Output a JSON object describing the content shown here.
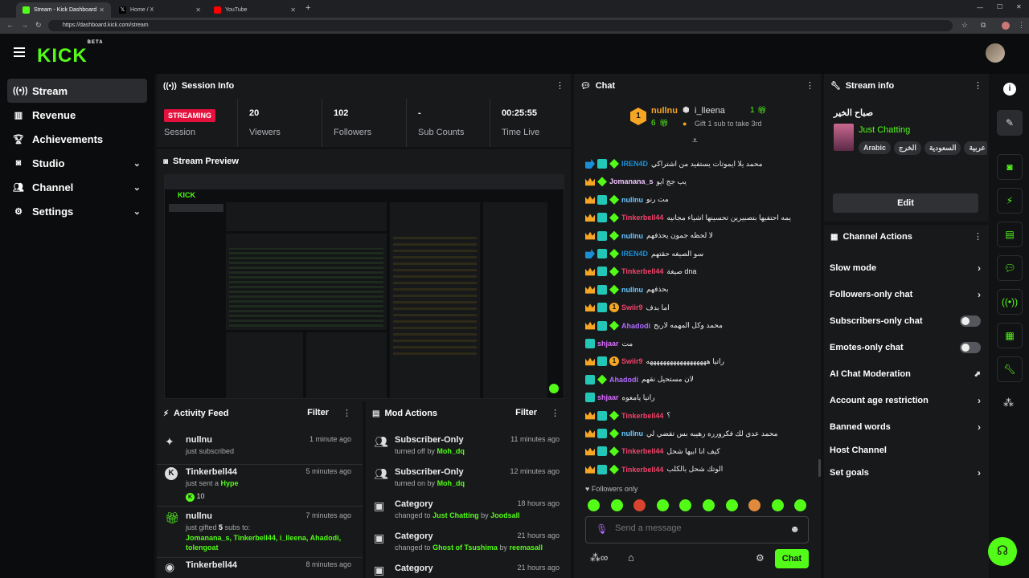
{
  "browser": {
    "tabs": [
      {
        "title": "Stream - Kick Dashboard"
      },
      {
        "title": "Home / X"
      },
      {
        "title": "YouTube"
      }
    ],
    "url": "https://dashboard.kick.com/stream"
  },
  "app": {
    "logo": "KICK",
    "logo_badge": "BETA"
  },
  "sidebar": {
    "items": [
      {
        "label": "Stream",
        "icon": "broadcast-icon"
      },
      {
        "label": "Revenue",
        "icon": "chart-icon"
      },
      {
        "label": "Achievements",
        "icon": "trophy-icon"
      },
      {
        "label": "Studio",
        "icon": "camera-icon"
      },
      {
        "label": "Channel",
        "icon": "users-icon"
      },
      {
        "label": "Settings",
        "icon": "gear-icon"
      }
    ]
  },
  "session": {
    "title": "Session Info",
    "badge": "STREAMING",
    "session_label": "Session",
    "stats": [
      {
        "value": "20",
        "label": "Viewers"
      },
      {
        "value": "102",
        "label": "Followers"
      },
      {
        "value": "-",
        "label": "Sub Counts"
      },
      {
        "value": "00:25:55",
        "label": "Time Live"
      }
    ]
  },
  "preview": {
    "title": "Stream Preview"
  },
  "activity": {
    "title": "Activity Feed",
    "filter": "Filter",
    "items": [
      {
        "name": "nullnu",
        "time": "1 minute ago",
        "text": "just subscribed"
      },
      {
        "name": "Tinkerbell44",
        "time": "5 minutes ago",
        "text": "just sent a",
        "highlight": "Hype",
        "amount": "10"
      },
      {
        "name": "nullnu",
        "time": "7 minutes ago",
        "text": "just gifted",
        "count": "5",
        "text2": "subs to:",
        "recipients": "Jomanana_s, Tinkerbell44, i_lleena, Ahadodi, tolengoat"
      },
      {
        "name": "Tinkerbell44",
        "time": "8 minutes ago"
      }
    ]
  },
  "modactions": {
    "title": "Mod Actions",
    "filter": "Filter",
    "items": [
      {
        "title": "Subscriber-Only",
        "time": "11 minutes ago",
        "text": "turned off by",
        "by": "Moh_dq"
      },
      {
        "title": "Subscriber-Only",
        "time": "12 minutes ago",
        "text": "turned on by",
        "by": "Moh_dq"
      },
      {
        "title": "Category",
        "time": "18 hours ago",
        "text": "changed to",
        "target": "Just Chatting",
        "by_text": "by",
        "by": "Joodsall"
      },
      {
        "title": "Category",
        "time": "21 hours ago",
        "text": "changed to",
        "target": "Ghost of Tsushima",
        "by_text": "by",
        "by": "reemasall"
      },
      {
        "title": "Category",
        "time": "21 hours ago"
      }
    ]
  },
  "chat": {
    "title": "Chat",
    "top_gifter": {
      "name": "nullnu",
      "count": "6",
      "rank": "1"
    },
    "second": {
      "name": "i_lleena",
      "count": "1"
    },
    "gift_prompt": "Gift 1 sub to take 3rd",
    "messages": [
      {
        "user": "IREN4D",
        "color": "#1b8fd6",
        "badges": [
          "sub",
          "teal",
          "diamond"
        ],
        "text": "محمد يلا ايموتات يستفيد من اشتراكي"
      },
      {
        "user": "Jomanana_s",
        "color": "#f2c4ff",
        "badges": [
          "crown",
          "diamond"
        ],
        "text": "يب جج ايو"
      },
      {
        "user": "nullnu",
        "color": "#67c6ff",
        "badges": [
          "crown",
          "teal",
          "diamond"
        ],
        "text": "مت رنو"
      },
      {
        "user": "Tinkerbell44",
        "color": "#f0436a",
        "badges": [
          "crown",
          "teal",
          "diamond"
        ],
        "text": "يمه احتفيها بتصبيرين تحسينها اشياء مجانيه"
      },
      {
        "user": "nullnu",
        "color": "#67c6ff",
        "badges": [
          "crown",
          "teal",
          "diamond"
        ],
        "text": "لا لحظه جمون يحذفهم"
      },
      {
        "user": "IREN4D",
        "color": "#1b8fd6",
        "badges": [
          "sub",
          "teal",
          "diamond"
        ],
        "text": "سو الصيغه حقتهم"
      },
      {
        "user": "Tinkerbell44",
        "color": "#f0436a",
        "badges": [
          "crown",
          "teal",
          "diamond"
        ],
        "text": "صيغة dna"
      },
      {
        "user": "nullnu",
        "color": "#67c6ff",
        "badges": [
          "crown",
          "teal",
          "diamond"
        ],
        "text": "بحذفهم"
      },
      {
        "user": "Swiir9",
        "color": "#f0436a",
        "badges": [
          "crown",
          "teal",
          "one"
        ],
        "text": "اما بدف"
      },
      {
        "user": "Ahadodi",
        "color": "#b06cff",
        "badges": [
          "crown",
          "teal",
          "diamond"
        ],
        "text": "محمد وكل المهمه لاربح"
      },
      {
        "user": "shjaar",
        "color": "#d96cff",
        "badges": [
          "teal"
        ],
        "text": "مت"
      },
      {
        "user": "Swiir9",
        "color": "#f0436a",
        "badges": [
          "crown",
          "teal",
          "one"
        ],
        "text": "راتيا ههههههههههههههههههه"
      },
      {
        "user": "Ahadodi",
        "color": "#b06cff",
        "badges": [
          "teal",
          "diamond"
        ],
        "text": "لان مستحيل نقهم"
      },
      {
        "user": "shjaar",
        "color": "#d96cff",
        "badges": [
          "teal"
        ],
        "text": "راتيا يامعوه"
      },
      {
        "user": "Tinkerbell44",
        "color": "#f0436a",
        "badges": [
          "crown",
          "teal",
          "diamond"
        ],
        "text": "؟"
      },
      {
        "user": "nullnu",
        "color": "#67c6ff",
        "badges": [
          "crown",
          "teal",
          "diamond"
        ],
        "text": "محمد عدي لك فكرورره رهيبه بس تقضي لي"
      },
      {
        "user": "Tinkerbell44",
        "color": "#f0436a",
        "badges": [
          "crown",
          "teal",
          "diamond"
        ],
        "text": "كيف انا ابيها شحل"
      },
      {
        "user": "Tinkerbell44",
        "color": "#f0436a",
        "badges": [
          "crown",
          "teal",
          "diamond"
        ],
        "text": "الوتك شحل بالكلب"
      }
    ],
    "followers_only": "Followers only",
    "input_placeholder": "Send a message",
    "send_label": "Chat"
  },
  "streaminfo": {
    "title": "Stream info",
    "stream_title": "صباح الخير",
    "category": "Just Chatting",
    "tags": [
      "Arabic",
      "الخرج",
      "السعودية",
      "عربية"
    ],
    "edit_label": "Edit"
  },
  "channelactions": {
    "title": "Channel Actions",
    "items": [
      {
        "label": "Slow mode",
        "control": "chevron"
      },
      {
        "label": "Followers-only chat",
        "control": "chevron"
      },
      {
        "label": "Subscribers-only chat",
        "control": "toggle"
      },
      {
        "label": "Emotes-only chat",
        "control": "toggle"
      },
      {
        "label": "AI Chat Moderation",
        "control": "external"
      },
      {
        "label": "Account age restriction",
        "control": "chevron"
      },
      {
        "label": "Banned words",
        "control": "chevron"
      },
      {
        "label": "Host Channel",
        "control": "none"
      },
      {
        "label": "Set goals",
        "control": "chevron"
      }
    ]
  },
  "colors": {
    "accent": "#53fc18",
    "streaming": "#e2123d",
    "panel": "#18191b",
    "background": "#0b0c0d"
  }
}
